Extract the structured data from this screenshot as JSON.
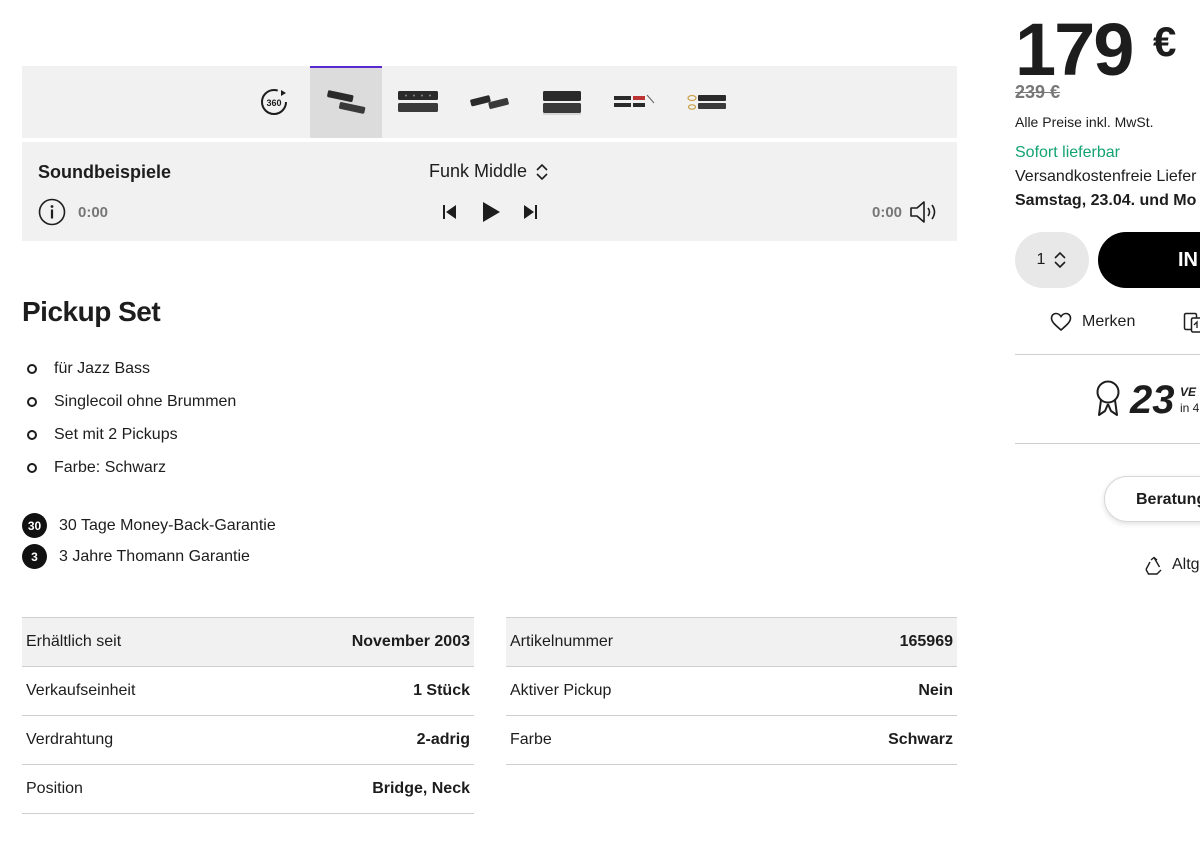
{
  "gallery": {
    "view360_label": "360",
    "thumbnails": [
      {
        "name": "pickup-pair-angled",
        "active": true
      },
      {
        "name": "pickup-pair-front"
      },
      {
        "name": "pickup-pair-side"
      },
      {
        "name": "pickup-pair-stacked"
      },
      {
        "name": "pickup-parts"
      },
      {
        "name": "pickup-with-cables"
      }
    ]
  },
  "sound": {
    "title": "Soundbeispiele",
    "preset": "Funk Middle",
    "time_current": "0:00",
    "time_total": "0:00"
  },
  "product": {
    "title": "Pickup Set",
    "features": [
      "für Jazz Bass",
      "Singlecoil ohne Brummen",
      "Set mit 2 Pickups",
      "Farbe: Schwarz"
    ],
    "guarantees": [
      {
        "badge": "30",
        "text": "30 Tage Money-Back-Garantie"
      },
      {
        "badge": "3",
        "text": "3 Jahre Thomann Garantie"
      }
    ]
  },
  "specs_left": [
    {
      "label": "Erhältlich seit",
      "value": "November 2003"
    },
    {
      "label": "Verkaufseinheit",
      "value": "1 Stück"
    },
    {
      "label": "Verdrahtung",
      "value": "2-adrig"
    },
    {
      "label": "Position",
      "value": "Bridge, Neck"
    }
  ],
  "specs_right": [
    {
      "label": "Artikelnummer",
      "value": "165969"
    },
    {
      "label": "Aktiver Pickup",
      "value": "Nein"
    },
    {
      "label": "Farbe",
      "value": "Schwarz"
    }
  ],
  "buybox": {
    "price": "179",
    "currency": "€",
    "old_price": "239 €",
    "vat_note": "Alle Preise inkl. MwSt.",
    "availability": "Sofort lieferbar",
    "shipping": "Versandkostenfreie Liefer",
    "delivery": "Samstag, 23.04. und Mo",
    "quantity": "1",
    "cart_label": "IN",
    "wishlist_label": "Merken",
    "award_number": "23",
    "award_label": "VE",
    "award_sub": "in 4",
    "advice_label": "Beratung",
    "used_label": "Altg"
  },
  "colors": {
    "accent": "#5a2ad0",
    "availability": "#12a372",
    "panel_bg": "#f1f1f1"
  }
}
